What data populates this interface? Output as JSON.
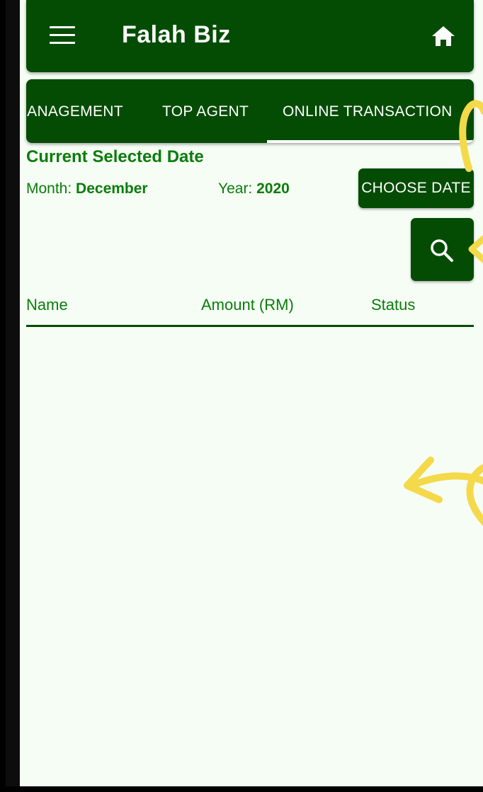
{
  "app": {
    "title": "Falah Biz"
  },
  "icons": {
    "menu": "menu-icon",
    "home": "home-icon",
    "search": "search-icon"
  },
  "tabs": [
    {
      "label": "MANAGEMENT",
      "shown_label": "IANAGEMENT",
      "selected": false
    },
    {
      "label": "TOP AGENT",
      "selected": false
    },
    {
      "label": "ONLINE TRANSACTION",
      "shown_label": "ONLINE TRANSACTION",
      "selected": true
    }
  ],
  "selection": {
    "title": "Current Selected Date",
    "month_label": "Month:",
    "month_value": "December",
    "year_label": "Year:",
    "year_value": "2020",
    "choose_date_label": "CHOOSE DATE"
  },
  "table": {
    "columns": [
      "Name",
      "Amount (RM)",
      "Status"
    ],
    "rows": []
  },
  "colors": {
    "primary": "#044c04",
    "text_green": "#0a7d0a",
    "background": "#f6fdf5",
    "annotation": "#f4d94a"
  }
}
